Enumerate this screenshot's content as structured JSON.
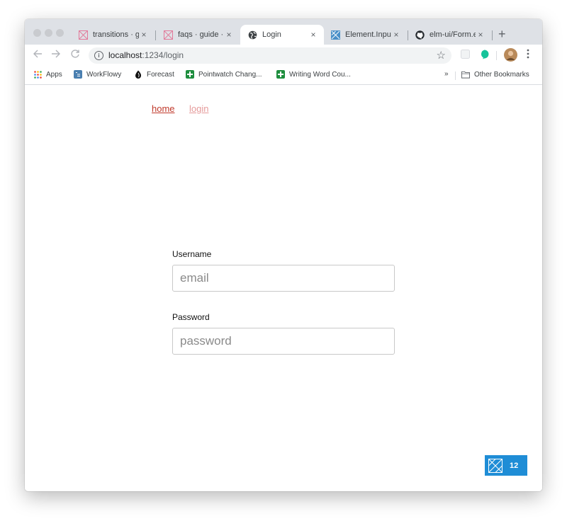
{
  "tabs": [
    {
      "label": "transitions · g",
      "favicon": "elm-logo-icon",
      "active": false
    },
    {
      "label": "faqs · guide · e",
      "favicon": "elm-logo-icon",
      "active": false
    },
    {
      "label": "Login",
      "favicon": "globe-icon",
      "active": true
    },
    {
      "label": "Element.Input",
      "favicon": "elm-ui-icon",
      "active": false
    },
    {
      "label": "elm-ui/Form.e",
      "favicon": "github-icon",
      "active": false
    }
  ],
  "tab_close_glyph": "×",
  "new_tab_glyph": "+",
  "address_bar": {
    "host": "localhost",
    "path": ":1234/login"
  },
  "bookmarks": {
    "items": [
      {
        "label": "Apps",
        "icon": "apps-grid-icon"
      },
      {
        "label": "WorkFlowy",
        "icon": "workflowy-icon"
      },
      {
        "label": "Forecast",
        "icon": "forecast-icon"
      },
      {
        "label": "Pointwatch Chang...",
        "icon": "sheets-icon"
      },
      {
        "label": "Writing Word Cou...",
        "icon": "sheets-icon"
      }
    ],
    "overflow": "»",
    "other": "Other Bookmarks"
  },
  "nav": {
    "home": "home",
    "login": "login"
  },
  "form": {
    "username_label": "Username",
    "username_placeholder": "email",
    "password_label": "Password",
    "password_placeholder": "password"
  },
  "badge": {
    "count": "12"
  },
  "colors": {
    "home_link": "#c0392b",
    "login_link": "#e59a9a",
    "badge": "#1f8dd6"
  }
}
